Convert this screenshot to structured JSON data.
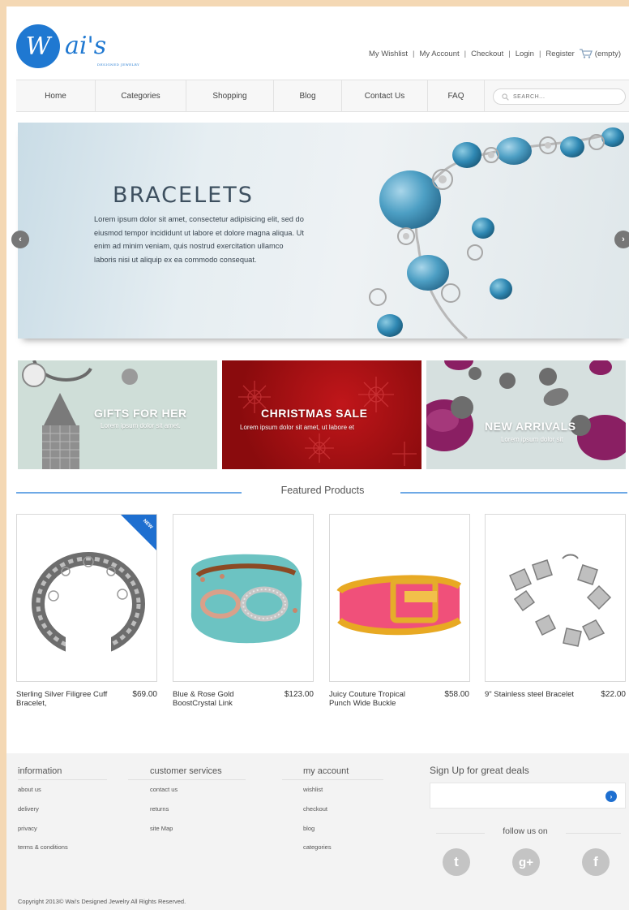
{
  "brand": {
    "logo_letter": "W",
    "name": "ai's",
    "tagline": "DESIGNED JEWELRY"
  },
  "top_links": {
    "wishlist": "My Wishlist",
    "account": "My Account",
    "checkout": "Checkout",
    "login": "Login",
    "register": "Register",
    "cart_status": "(empty)",
    "separator": "|"
  },
  "nav": {
    "items": [
      "Home",
      "Categories",
      "Shopping",
      "Blog",
      "Contact Us",
      "FAQ"
    ],
    "search_placeholder": "SEARCH..."
  },
  "hero": {
    "title": "BRACELETS",
    "body": "Lorem ipsum dolor sit amet, consectetur adipisicing elit, sed do eiusmod tempor incididunt ut labore et dolore magna aliqua. Ut enim ad minim veniam, quis nostrud exercitation ullamco laboris nisi ut aliquip ex ea commodo consequat.",
    "prev_symbol": "‹",
    "next_symbol": "›"
  },
  "promos": [
    {
      "title": "GIFTS FOR HER",
      "subtitle": "Lorem ipsum dolor sit amet."
    },
    {
      "title": "CHRISTMAS SALE",
      "subtitle": "Lorem ipsum dolor sit amet, ut labore et"
    },
    {
      "title": "NEW ARRIVALS",
      "subtitle": "Lorem ipsum dolor sit"
    }
  ],
  "featured": {
    "title": "Featured Products",
    "badge": "NEW",
    "products": [
      {
        "name": "Sterling Silver Filigree Cuff Bracelet,",
        "price": "$69.00"
      },
      {
        "name": "Blue & Rose Gold BoostCrystal Link",
        "price": "$123.00"
      },
      {
        "name": "Juicy Couture Tropical Punch Wide Buckle",
        "price": "$58.00"
      },
      {
        "name": "9\" Stainless steel Bracelet",
        "price": "$22.00"
      }
    ]
  },
  "footer": {
    "information": {
      "title": "information",
      "links": [
        "about us",
        "delivery",
        "privacy",
        "terms & conditions"
      ]
    },
    "customer_services": {
      "title": "customer services",
      "links": [
        "contact us",
        "returns",
        "site Map"
      ]
    },
    "my_account": {
      "title": "my account",
      "links": [
        "wishlist",
        "checkout",
        "blog",
        "categories"
      ]
    },
    "signup": {
      "title": "Sign Up for great deals",
      "go_symbol": "›"
    },
    "follow": {
      "title": "follow us on",
      "twitter": "t",
      "google": "g+",
      "facebook": "f"
    },
    "copyright": "Copyright 2013© Wai's Designed Jewelry All Rights Reserved."
  },
  "colors": {
    "brand_blue": "#1f78d1",
    "accent_line": "#6ea9e6",
    "page_background": "#f4d8b4",
    "promo_red": "#b01216"
  },
  "icons": {
    "cart": "cart-icon",
    "search": "search-icon",
    "slider_prev": "chevron-left-icon",
    "slider_next": "chevron-right-icon",
    "newsletter_submit": "arrow-right-circle-icon",
    "twitter": "twitter-icon",
    "google_plus": "google-plus-icon",
    "facebook": "facebook-icon"
  }
}
